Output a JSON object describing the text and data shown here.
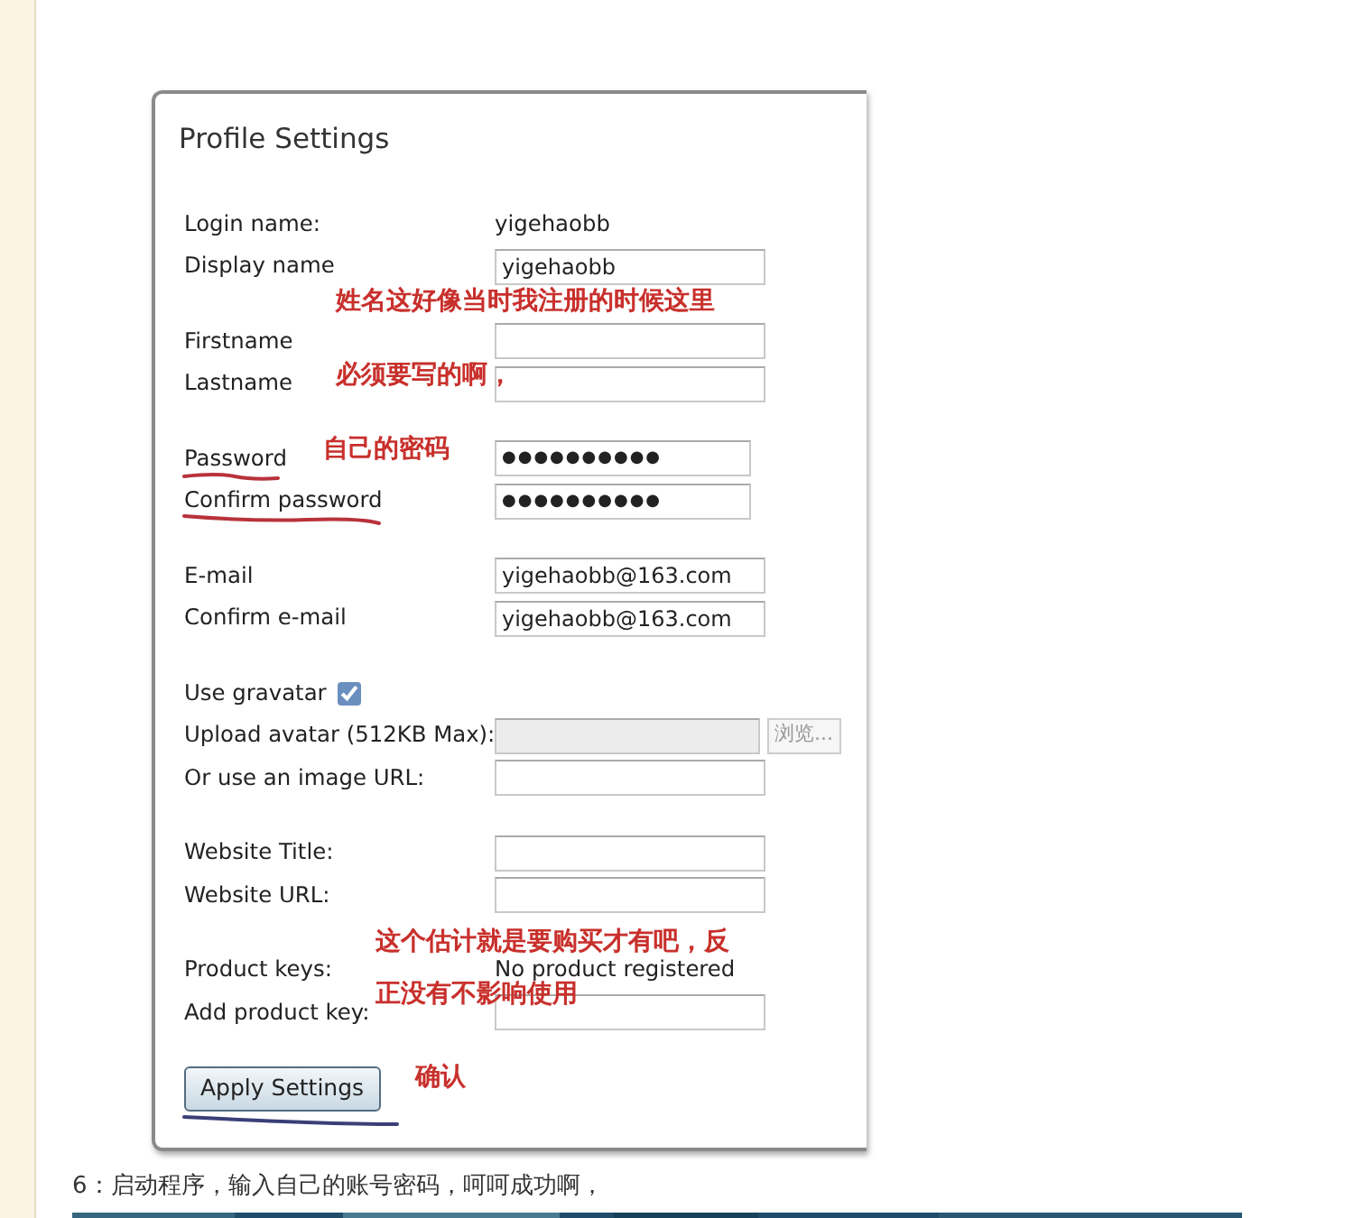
{
  "window": {
    "title": "Profile Settings"
  },
  "sections": [
    {
      "rows": [
        {
          "kind": "static",
          "label": "Login name:",
          "value": "yigehaobb"
        },
        {
          "kind": "input",
          "label": "Display name",
          "value": "yigehaobb"
        }
      ]
    },
    {
      "rows": [
        {
          "kind": "input",
          "label": "Firstname",
          "note": "姓名这好像当时我注册的时候这里"
        },
        {
          "kind": "input",
          "label": "Lastname",
          "note": "必须要写的啊，"
        }
      ]
    },
    {
      "rows": [
        {
          "kind": "password",
          "label": "Password",
          "value": "●●●●●●●●●●",
          "note": "自己的密码",
          "underlined": true
        },
        {
          "kind": "password",
          "label": "Confirm password",
          "value": "●●●●●●●●●●",
          "underlined": true
        }
      ]
    },
    {
      "rows": [
        {
          "kind": "input",
          "label": "E-mail",
          "value": "yigehaobb@163.com"
        },
        {
          "kind": "input",
          "label": "Confirm e-mail",
          "value": "yigehaobb@163.com"
        }
      ]
    },
    {
      "rows": [
        {
          "kind": "checkbox",
          "label": "Use gravatar",
          "checked": true
        },
        {
          "kind": "file",
          "label": "Upload avatar (512KB Max):",
          "disabled": true,
          "button": "浏览..."
        },
        {
          "kind": "input",
          "label": "Or use an image URL:"
        }
      ]
    },
    {
      "rows": [
        {
          "kind": "input",
          "label": "Website Title:"
        },
        {
          "kind": "input",
          "label": "Website URL:"
        }
      ]
    },
    {
      "rows": [
        {
          "kind": "static",
          "label": "Product keys:",
          "value": "No product registered",
          "note": "这个估计就是要购买才有吧，反"
        },
        {
          "kind": "input",
          "label": "Add product key:",
          "note": "正没有不影响使用"
        }
      ]
    }
  ],
  "apply_button": {
    "label": "Apply Settings",
    "note": "确认",
    "underlined": true
  },
  "caption": "6：启动程序，输入自己的账号密码，呵呵成功啊，"
}
